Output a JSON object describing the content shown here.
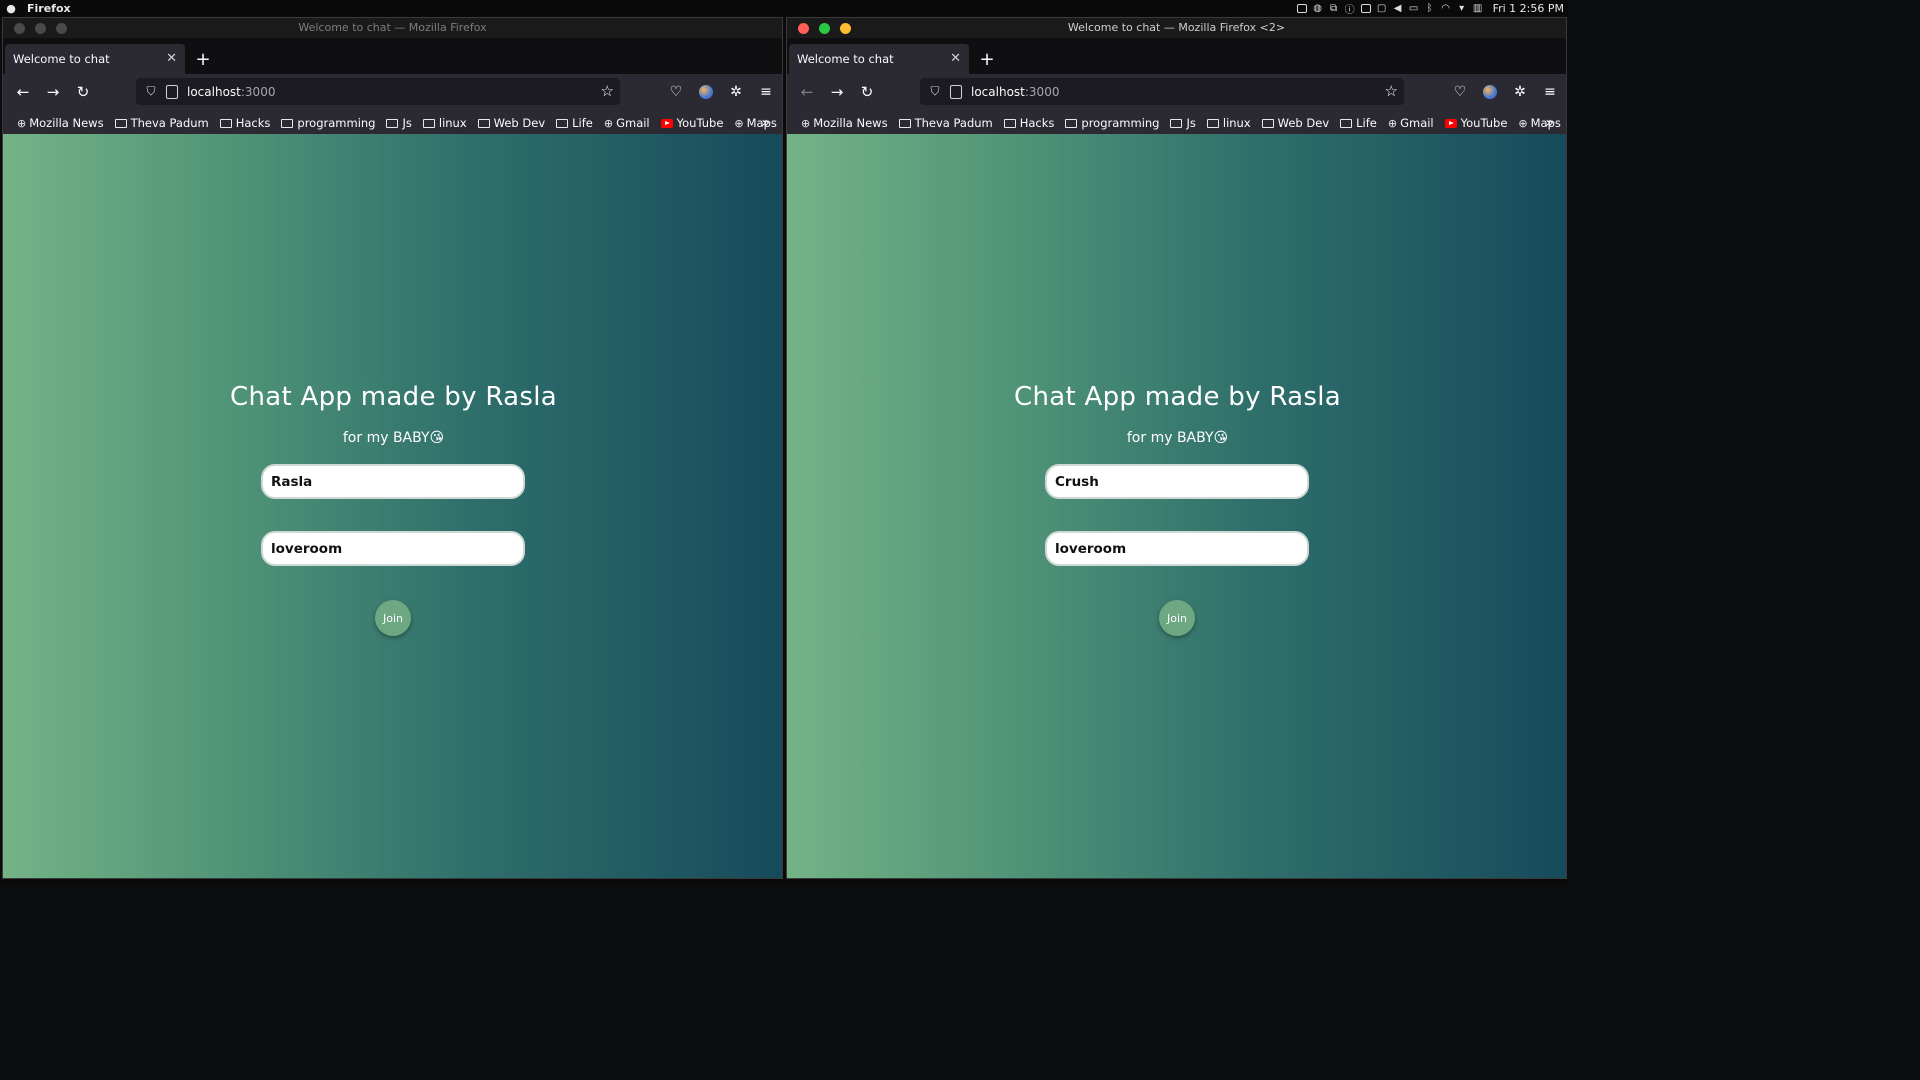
{
  "menubar": {
    "app_name": "Firefox",
    "clock": "Fri 1   2:56 PM"
  },
  "windows": [
    {
      "title": "Welcome to chat — Mozilla Firefox",
      "tab_title": "Welcome to chat",
      "url_host": "localhost",
      "url_port": ":3000",
      "bookmarks": [
        "Mozilla News",
        "Theva Padum",
        "Hacks",
        "programming",
        "Js",
        "linux",
        "Web Dev",
        "Life",
        "Gmail",
        "YouTube",
        "Maps"
      ],
      "page": {
        "heading": "Chat App made by Rasla",
        "subheading": "for my BABY😘",
        "name_value": "Rasla",
        "room_value": "loveroom",
        "join_label": "Join"
      }
    },
    {
      "title": "Welcome to chat — Mozilla Firefox <2>",
      "tab_title": "Welcome to chat",
      "url_host": "localhost",
      "url_port": ":3000",
      "bookmarks": [
        "Mozilla News",
        "Theva Padum",
        "Hacks",
        "programming",
        "Js",
        "linux",
        "Web Dev",
        "Life",
        "Gmail",
        "YouTube",
        "Maps"
      ],
      "page": {
        "heading": "Chat App made by Rasla",
        "subheading": "for my BABY😘",
        "name_value": "Crush",
        "room_value": "loveroom",
        "join_label": "Join"
      }
    }
  ],
  "colors": {
    "gradient_start": "#74b386",
    "gradient_end": "#164a5c",
    "join_button": "#6ea882"
  }
}
